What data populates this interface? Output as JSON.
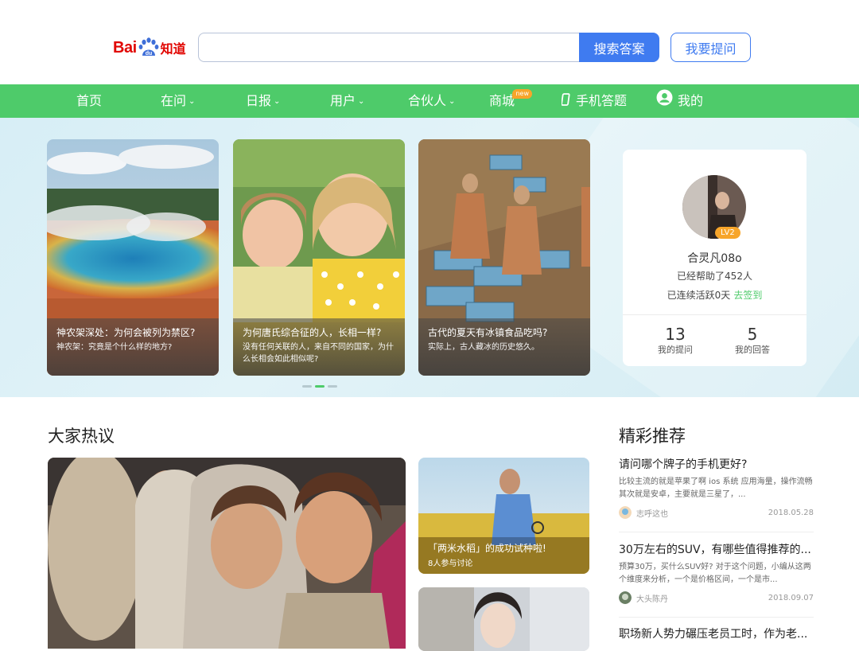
{
  "header": {
    "logo_text": "Bai",
    "logo_paw_text": "du",
    "logo_suffix": "知道",
    "search": {
      "value": "",
      "placeholder": ""
    },
    "search_button": "搜索答案",
    "ask_button": "我要提问"
  },
  "nav": {
    "items": [
      {
        "label": "首页",
        "dropdown": false
      },
      {
        "label": "在问",
        "dropdown": true
      },
      {
        "label": "日报",
        "dropdown": true
      },
      {
        "label": "用户",
        "dropdown": true
      },
      {
        "label": "合伙人",
        "dropdown": true
      },
      {
        "label": "商城",
        "badge": "new"
      },
      {
        "label": "手机答题",
        "icon": "mobile-icon"
      },
      {
        "label": "我的",
        "icon": "user-circle-icon"
      }
    ],
    "chevron": "⌄"
  },
  "banner": {
    "cards": [
      {
        "title": "神农架深处：为何会被列为禁区?",
        "subtitle": "神农架：究竟是个什么样的地方?"
      },
      {
        "title": "为何唐氏综合征的人，长相一样?",
        "subtitle": "没有任何关联的人，来自不同的国家，为什么长相会如此相似呢?"
      },
      {
        "title": "古代的夏天有冰镇食品吃吗?",
        "subtitle": "实际上，古人藏冰的历史悠久。"
      }
    ],
    "dots": 3,
    "active_dot": 1
  },
  "user": {
    "level": "LV2",
    "name": "合灵凡08o",
    "helped": "已经帮助了452人",
    "streak": "已连续活跃0天",
    "sign_in": "去签到",
    "questions_count": "13",
    "questions_label": "我的提问",
    "answers_count": "5",
    "answers_label": "我的回答"
  },
  "hot": {
    "title": "大家热议",
    "side_items": [
      {
        "title": "「两米水稻」的成功试种啦!",
        "meta": "8人参与讨论"
      }
    ]
  },
  "recommend": {
    "title": "精彩推荐",
    "items": [
      {
        "title": "请问哪个牌子的手机更好?",
        "desc": "比较主流的就是苹果了啊 ios 系统 应用海量，操作流畅 其次就是安卓，主要就是三星了，...",
        "author": "志呼这也",
        "date": "2018.05.28"
      },
      {
        "title": "30万左右的SUV，有哪些值得推荐的...",
        "desc": "预算30万，买什么SUV好? 对于这个问题，小编从这两个维度来分析，一个是价格区间，一个是市...",
        "author": "大头陈丹",
        "date": "2018.09.07"
      },
      {
        "title": "职场新人势力碾压老员工时，作为老..."
      }
    ]
  },
  "colors": {
    "green": "#4ecb6a",
    "blue": "#3f7bf0",
    "orange": "#f7a52a",
    "logo_red": "#e10602"
  }
}
